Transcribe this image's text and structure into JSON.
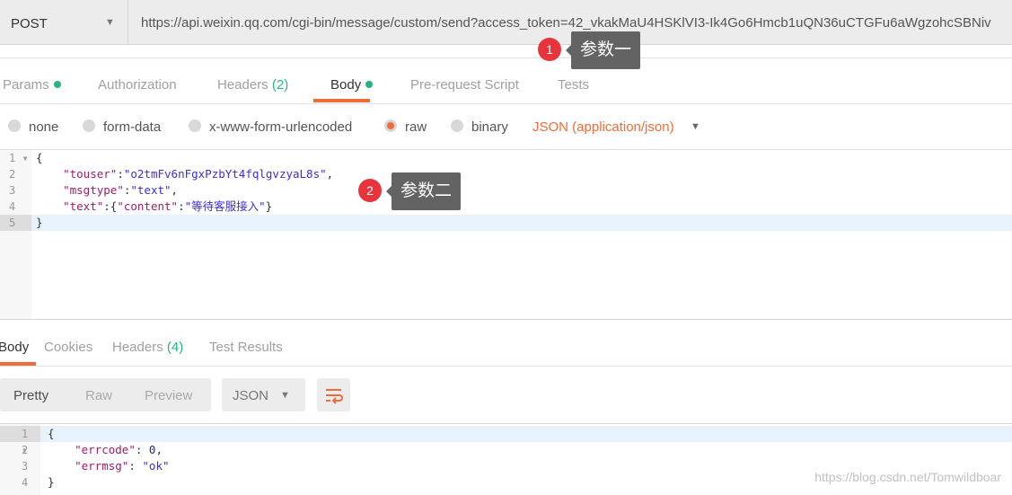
{
  "request": {
    "method": "POST",
    "url": "https://api.weixin.qq.com/cgi-bin/message/custom/send?access_token=42_vkakMaU4HSKlVI3-Ik4Go6Hmcb1uQN36uCTGFu6aWgzohcSBNiv"
  },
  "request_tabs": [
    {
      "label": "Params"
    },
    {
      "label": "Authorization"
    },
    {
      "label": "Headers",
      "count": "(2)"
    },
    {
      "label": "Body",
      "active": true
    },
    {
      "label": "Pre-request Script"
    },
    {
      "label": "Tests"
    }
  ],
  "body_modes": [
    "none",
    "form-data",
    "x-www-form-urlencoded",
    "raw",
    "binary"
  ],
  "selected_mode": "raw",
  "body_type": "JSON (application/json)",
  "request_body": {
    "line_numbers": [
      "1",
      "2",
      "3",
      "4",
      "5"
    ],
    "lines": [
      {
        "p": "{"
      },
      {
        "k": "\"touser\"",
        "sep": ":",
        "v": "\"o2tmFv6nFgxPzbYt4fqlgvzyaL8s\"",
        "end": ","
      },
      {
        "k": "\"msgtype\"",
        "sep": ":",
        "v": "\"text\"",
        "end": ","
      },
      {
        "k": "\"text\"",
        "sep": ":{",
        "k2": "\"content\"",
        "sep2": ":",
        "v": "\"等待客服接入\"",
        "end": "}"
      },
      {
        "p": "}"
      }
    ]
  },
  "annotations": [
    {
      "number": "1",
      "label": "参数一"
    },
    {
      "number": "2",
      "label": "参数二"
    }
  ],
  "response_tabs": [
    {
      "label": "Body",
      "active": true
    },
    {
      "label": "Cookies"
    },
    {
      "label": "Headers",
      "count": "(4)"
    },
    {
      "label": "Test Results"
    }
  ],
  "view_modes": [
    "Pretty",
    "Raw",
    "Preview"
  ],
  "response_format": "JSON",
  "response_body": {
    "line_numbers": [
      "1",
      "2",
      "3",
      "4"
    ],
    "open": "{",
    "close": "}",
    "errcode_key": "\"errcode\"",
    "errcode_val": "0",
    "errmsg_key": "\"errmsg\"",
    "errmsg_val": "\"ok\""
  },
  "watermark": "https://blog.csdn.net/Tomwildboar",
  "colors": {
    "accent": "#f26b3a",
    "green": "#26b47f",
    "badge": "#e8343a"
  }
}
